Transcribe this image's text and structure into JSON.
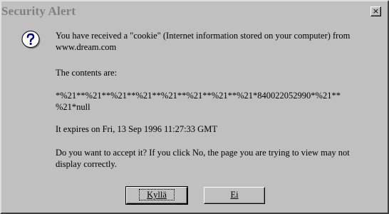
{
  "dialog": {
    "title": "Security Alert",
    "close_glyph": "×",
    "icon": "question-icon",
    "message": {
      "line1": "You have received a \"cookie\" (Internet  information stored on your computer) from www.dream.com",
      "line2": "The contents are:",
      "line3": "*%21**%21**%21**%21**%21**%21**%21**%21*840022052990*%21** %21*null",
      "line4": "It expires on Fri, 13 Sep 1996 11:27:33 GMT",
      "line5": "Do you want to accept it? If you click No, the page you are trying to view may not display correctly."
    },
    "buttons": {
      "yes_label": "Kyllä",
      "no_label": "Ei"
    }
  }
}
